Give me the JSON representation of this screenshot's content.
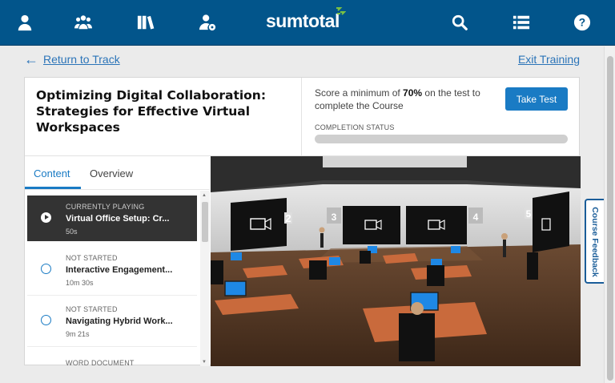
{
  "topbar": {
    "logo_text": "sumtotal",
    "icons": [
      "user-icon",
      "users-icon",
      "library-icon",
      "user-settings-icon",
      "search-icon",
      "list-icon",
      "help-icon"
    ],
    "bg_color": "#02558b"
  },
  "nav": {
    "back_label": "Return to Track",
    "exit_label": "Exit Training"
  },
  "course": {
    "title": "Optimizing Digital Collaboration: Strategies for Effective Virtual Workspaces",
    "score_text_prefix": "Score a minimum of",
    "score_percent": "70%",
    "score_text_suffix": "on the test to complete the Course",
    "take_test_label": "Take Test",
    "completion_label": "COMPLETION STATUS",
    "completion_fraction": 0
  },
  "tabs": {
    "content": "Content",
    "overview": "Overview"
  },
  "items": [
    {
      "status": "CURRENTLY PLAYING",
      "name": "Virtual Office Setup: Cr...",
      "duration": "50s"
    },
    {
      "status": "NOT STARTED",
      "name": "Interactive Engagement...",
      "duration": "10m 30s"
    },
    {
      "status": "NOT STARTED",
      "name": "Navigating Hybrid Work...",
      "duration": "9m 21s"
    },
    {
      "status": "WORD DOCUMENT",
      "name": "",
      "duration": ""
    }
  ],
  "scene": {
    "screen_numbers": [
      "2",
      "3",
      "4",
      "5"
    ]
  },
  "feedback": {
    "label": "Course Feedback"
  },
  "colors": {
    "accent": "#1a7bc4",
    "link": "#2b74b8"
  }
}
